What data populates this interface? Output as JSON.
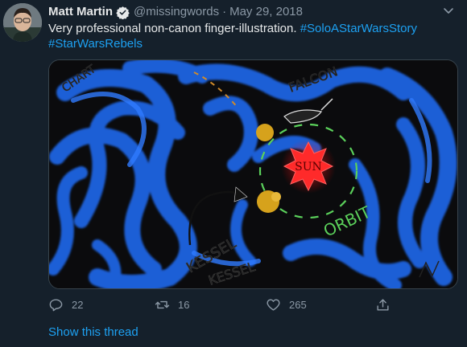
{
  "user": {
    "name": "Matt Martin",
    "handle": "@missingwords",
    "separator": "·",
    "date": "May 29, 2018"
  },
  "tweet": {
    "text_main": "Very professional non-canon finger-illustration.",
    "hashtag_1": "#SoloAStarWarsStory",
    "hashtag_2": "#StarWarsRebels"
  },
  "drawing": {
    "label_sun": "SUN",
    "label_orbit": "ORBIT",
    "label_kessel": "KESSEL",
    "label_kessel_2": "KESSEL",
    "label_falcon": "FALCON",
    "label_chart": "CHART"
  },
  "actions": {
    "replies": "22",
    "retweets": "16",
    "likes": "265"
  },
  "thread_link": "Show this thread",
  "colors": {
    "background": "#15202b",
    "accent": "#1da1f2",
    "text": "#e7e9ea",
    "muted": "#8b98a5"
  },
  "icons": [
    "verified-icon",
    "more-icon",
    "reply-icon",
    "retweet-icon",
    "like-icon",
    "share-icon"
  ]
}
